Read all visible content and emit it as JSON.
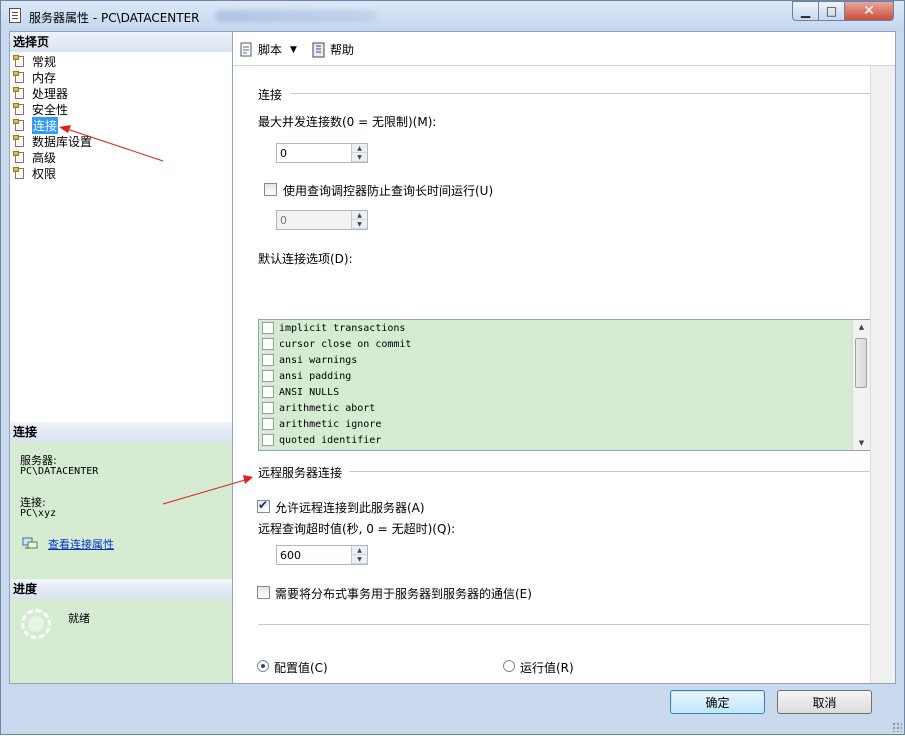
{
  "window": {
    "title": "服务器属性 - PC\\DATACENTER"
  },
  "left_panel": {
    "select_page_header": "选择页",
    "nav_items": [
      {
        "label": "常规",
        "selected": false
      },
      {
        "label": "内存",
        "selected": false
      },
      {
        "label": "处理器",
        "selected": false
      },
      {
        "label": "安全性",
        "selected": false
      },
      {
        "label": "连接",
        "selected": true
      },
      {
        "label": "数据库设置",
        "selected": false
      },
      {
        "label": "高级",
        "selected": false
      },
      {
        "label": "权限",
        "selected": false
      }
    ],
    "connection_header": "连接",
    "server_label": "服务器:",
    "server_value": "PC\\DATACENTER",
    "conn_label": "连接:",
    "conn_value": "PC\\xyz",
    "view_props_link": "查看连接属性",
    "progress_header": "进度",
    "progress_status": "就绪"
  },
  "toolbar": {
    "script_label": "脚本",
    "help_label": "帮助"
  },
  "main": {
    "conn_group_title": "连接",
    "max_conn_label": "最大并发连接数(0 = 无限制)(M):",
    "max_conn_value": "0",
    "query_governor_label": "使用查询调控器防止查询长时间运行(U)",
    "query_governor_checked": false,
    "query_governor_value": "0",
    "default_options_label": "默认连接选项(D):",
    "options": [
      {
        "label": "implicit transactions",
        "checked": false
      },
      {
        "label": "cursor close on commit",
        "checked": false
      },
      {
        "label": "ansi warnings",
        "checked": false
      },
      {
        "label": "ansi padding",
        "checked": false
      },
      {
        "label": "ANSI NULLS",
        "checked": false
      },
      {
        "label": "arithmetic abort",
        "checked": false
      },
      {
        "label": "arithmetic ignore",
        "checked": false
      },
      {
        "label": "quoted identifier",
        "checked": false
      }
    ],
    "remote_group_title": "远程服务器连接",
    "allow_remote_label": "允许远程连接到此服务器(A)",
    "allow_remote_checked": true,
    "remote_timeout_label": "远程查询超时值(秒, 0 = 无超时)(Q):",
    "remote_timeout_value": "600",
    "distributed_tx_label": "需要将分布式事务用于服务器到服务器的通信(E)",
    "distributed_tx_checked": false,
    "config_value_label": "配置值(C)",
    "running_value_label": "运行值(R)",
    "selected_radio": "config"
  },
  "footer": {
    "ok_label": "确定",
    "cancel_label": "取消"
  },
  "colors": {
    "accent": "#3399ff",
    "panel_green": "#d5ecd2",
    "annotation_red": "#e02020"
  }
}
